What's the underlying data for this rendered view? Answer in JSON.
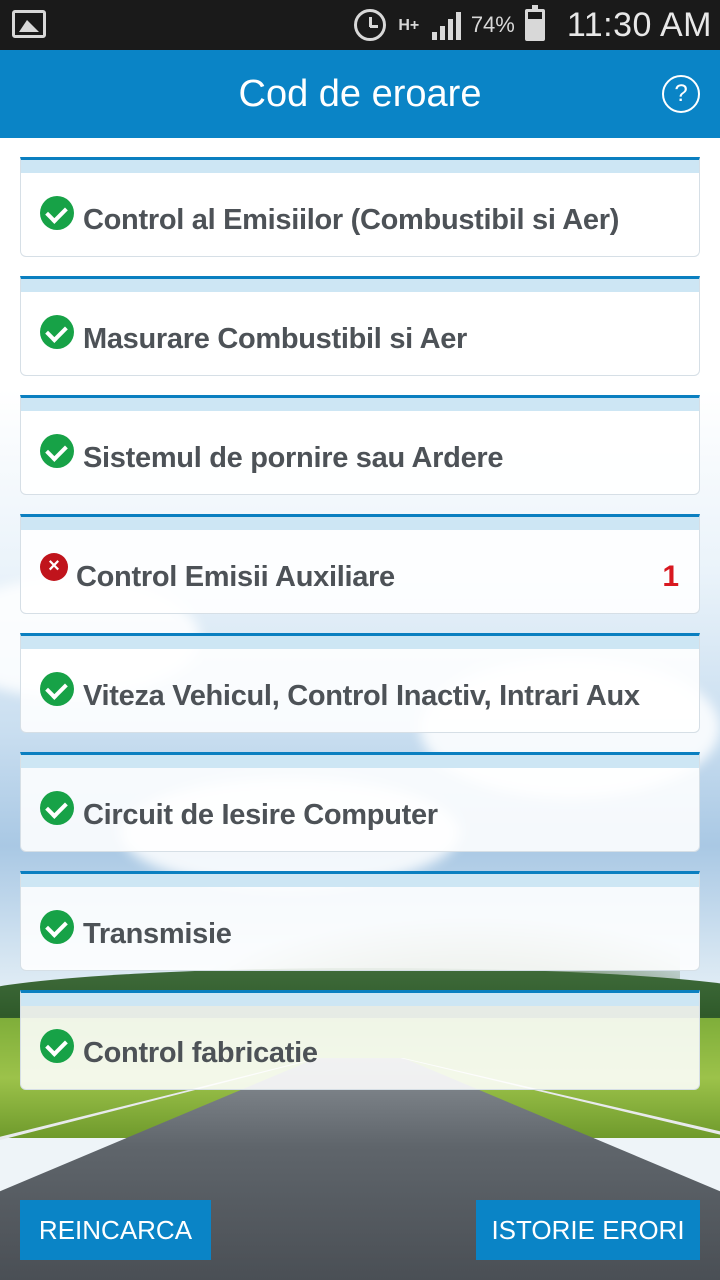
{
  "status_bar": {
    "network": "H+",
    "battery": "74%",
    "time": "11:30 AM"
  },
  "header": {
    "title": "Cod de eroare",
    "help_label": "?"
  },
  "list": [
    {
      "label": "Control al Emisiilor (Combustibil si Aer)",
      "status": "ok",
      "count": ""
    },
    {
      "label": "Masurare Combustibil si Aer",
      "status": "ok",
      "count": ""
    },
    {
      "label": "Sistemul de pornire sau Ardere",
      "status": "ok",
      "count": ""
    },
    {
      "label": "Control Emisii Auxiliare",
      "status": "error",
      "count": "1"
    },
    {
      "label": "Viteza Vehicul, Control Inactiv, Intrari Aux",
      "status": "ok",
      "count": ""
    },
    {
      "label": "Circuit de Iesire Computer",
      "status": "ok",
      "count": ""
    },
    {
      "label": "Transmisie",
      "status": "ok",
      "count": ""
    },
    {
      "label": "Control fabricatie",
      "status": "ok",
      "count": ""
    }
  ],
  "buttons": {
    "reload": "REINCARCA",
    "history": "ISTORIE ERORI"
  },
  "icons": {
    "ok": "check-circle-icon",
    "error": "x-circle-icon"
  },
  "colors": {
    "primary": "#0a84c6",
    "ok": "#17a247",
    "error": "#c0141c",
    "count": "#d81820"
  }
}
